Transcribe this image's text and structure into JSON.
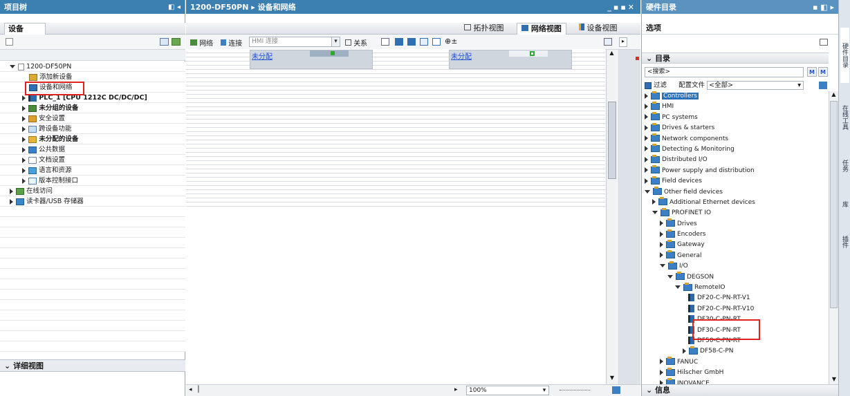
{
  "left": {
    "title": "项目树",
    "devices_tab": "设备",
    "tree": [
      {
        "label": "1200-DF50PN",
        "indent": 0,
        "open": true,
        "bold": false
      },
      {
        "label": "添加新设备",
        "indent": 2,
        "bold": false
      },
      {
        "label": "设备和网络",
        "indent": 2,
        "bold": false
      },
      {
        "label": "PLC_1 [CPU 1212C DC/DC/DC]",
        "indent": 1,
        "bold": true
      },
      {
        "label": "未分组的设备",
        "indent": 1,
        "bold": true
      },
      {
        "label": "安全设置",
        "indent": 1,
        "bold": false
      },
      {
        "label": "跨设备功能",
        "indent": 1,
        "bold": false
      },
      {
        "label": "未分配的设备",
        "indent": 1,
        "bold": true
      },
      {
        "label": "公共数据",
        "indent": 1,
        "bold": false
      },
      {
        "label": "文档设置",
        "indent": 1,
        "bold": false
      },
      {
        "label": "语言和资源",
        "indent": 1,
        "bold": false
      },
      {
        "label": "版本控制接口",
        "indent": 1,
        "bold": false
      },
      {
        "label": "在线访问",
        "indent": 0,
        "bold": false
      },
      {
        "label": "读卡器/USB 存储器",
        "indent": 0,
        "bold": false
      }
    ],
    "detail_view": "详细视图"
  },
  "center": {
    "breadcrumb": "1200-DF50PN ▸ 设备和网络",
    "tabs": [
      "拓扑视图",
      "网络视图",
      "设备视图"
    ],
    "active_tab": "网络视图",
    "toolbar": {
      "network": "网络",
      "connection": "连接",
      "conn_type": "HMI 连接",
      "relation": "关系"
    },
    "devices": [
      "未分配",
      "未分配"
    ],
    "zoom": "100%"
  },
  "right": {
    "title": "硬件目录",
    "options": "选项",
    "catalog_label": "目录",
    "search_placeholder": "<搜索>",
    "filter_label": "过滤",
    "profile_label": "配置文件",
    "profile_value": "<全部>",
    "info_label": "信息",
    "items": [
      {
        "label": "Controllers",
        "level": 0,
        "open": false,
        "selected": true
      },
      {
        "label": "HMI",
        "level": 0,
        "open": false
      },
      {
        "label": "PC systems",
        "level": 0,
        "open": false
      },
      {
        "label": "Drives & starters",
        "level": 0,
        "open": false
      },
      {
        "label": "Network components",
        "level": 0,
        "open": false
      },
      {
        "label": "Detecting & Monitoring",
        "level": 0,
        "open": false
      },
      {
        "label": "Distributed I/O",
        "level": 0,
        "open": false
      },
      {
        "label": "Power supply and distribution",
        "level": 0,
        "open": false
      },
      {
        "label": "Field devices",
        "level": 0,
        "open": false
      },
      {
        "label": "Other field devices",
        "level": 0,
        "open": true
      },
      {
        "label": "Additional Ethernet devices",
        "level": 1,
        "open": false
      },
      {
        "label": "PROFINET IO",
        "level": 1,
        "open": true
      },
      {
        "label": "Drives",
        "level": 2,
        "open": false
      },
      {
        "label": "Encoders",
        "level": 2,
        "open": false
      },
      {
        "label": "Gateway",
        "level": 2,
        "open": false
      },
      {
        "label": "General",
        "level": 2,
        "open": false
      },
      {
        "label": "I/O",
        "level": 2,
        "open": true
      },
      {
        "label": "DEGSON",
        "level": 3,
        "open": true
      },
      {
        "label": "RemoteIO",
        "level": 4,
        "open": true
      },
      {
        "label": "DF20-C-PN-RT-V1",
        "level": 5,
        "device": true
      },
      {
        "label": "DF20-C-PN-RT-V10",
        "level": 5,
        "device": true
      },
      {
        "label": "DF30-C-PN-RT",
        "level": 5,
        "device": true
      },
      {
        "label": "DF30-C-PN-RT",
        "level": 5,
        "device": true
      },
      {
        "label": "DF50-C-PN-RT",
        "level": 5,
        "device": true
      },
      {
        "label": "DF58-C-PN",
        "level": 5,
        "open": false
      },
      {
        "label": "FANUC",
        "level": 2,
        "open": false
      },
      {
        "label": "Hilscher GmbH",
        "level": 2,
        "open": false
      },
      {
        "label": "INOVANCE",
        "level": 2,
        "open": false
      }
    ]
  },
  "side_tabs": [
    "硬件目录",
    "在线工具",
    "任务",
    "库",
    "插件"
  ]
}
